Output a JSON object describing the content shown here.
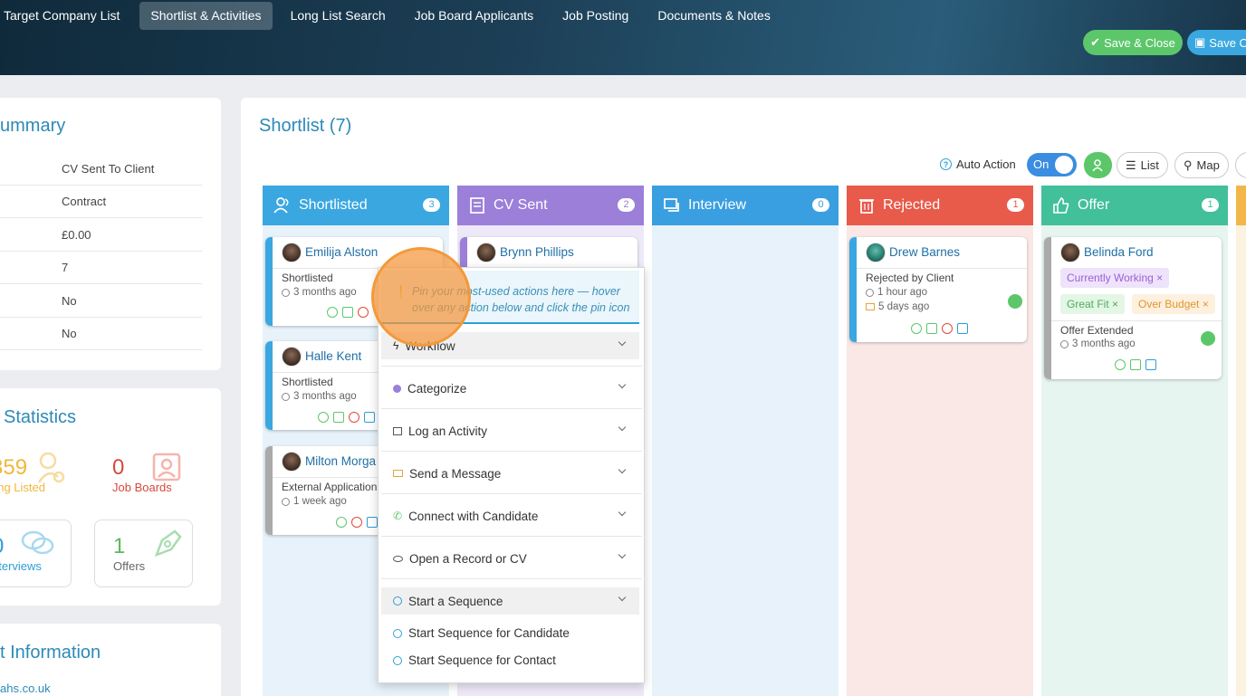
{
  "topbar": {
    "tabs": [
      "Target Company List",
      "Shortlist & Activities",
      "Long List Search",
      "Job Board Applicants",
      "Job Posting",
      "Documents & Notes"
    ],
    "active_tab": "Shortlist & Activities",
    "save_close": "Save & Close",
    "save_only": "Save Or"
  },
  "summary": {
    "title": "ummary",
    "rows": [
      "CV Sent To Client",
      "Contract",
      "£0.00",
      "7",
      "No",
      "No"
    ]
  },
  "statistics": {
    "title": "Statistics",
    "long_listed_num": "359",
    "long_listed_label": "ong Listed",
    "job_boards_num": "0",
    "job_boards_label": "Job Boards",
    "interviews_num": "0",
    "interviews_label": "nterviews",
    "offers_num": "1",
    "offers_label": "Offers"
  },
  "contact": {
    "title": "t Information",
    "email": "ahs.co.uk"
  },
  "main": {
    "title": "Shortlist (7)",
    "auto_action": "Auto Action",
    "toggle": "On",
    "list": "List",
    "map": "Map"
  },
  "columns": [
    {
      "name": "Shortlisted",
      "count": "3",
      "color": "#3aa7e0"
    },
    {
      "name": "CV Sent",
      "count": "2",
      "color": "#9b7fd9"
    },
    {
      "name": "Interview",
      "count": "0",
      "color": "#3a9fe0"
    },
    {
      "name": "Rejected",
      "count": "1",
      "color": "#e85a4a"
    },
    {
      "name": "Offer",
      "count": "1",
      "color": "#42c09a"
    }
  ],
  "cards": {
    "emilija": {
      "name": "Emilija Alston",
      "status": "Shortlisted",
      "time": "3 months ago"
    },
    "halle": {
      "name": "Halle Kent",
      "status": "Shortlisted",
      "time": "3 months ago"
    },
    "milton": {
      "name": "Milton Morga",
      "status": "External Application",
      "time": "1 week ago"
    },
    "brynn": {
      "name": "Brynn Phillips"
    },
    "drew": {
      "name": "Drew Barnes",
      "status": "Rejected by Client",
      "time": "1 hour ago",
      "time2": "5 days ago"
    },
    "belinda": {
      "name": "Belinda Ford",
      "tag1": "Currently Working",
      "tag2": "Great Fit",
      "tag3": "Over Budget",
      "status": "Offer Extended",
      "time": "3 months ago"
    }
  },
  "dropdown": {
    "pin_hint": "Pin your most-used actions here — hover over any action below and click the pin icon",
    "items": [
      "Workflow",
      "Categorize",
      "Log an Activity",
      "Send a Message",
      "Connect with Candidate",
      "Open a Record or CV",
      "Start a Sequence"
    ],
    "sub_items": [
      "Start Sequence for Candidate",
      "Start Sequence for Contact"
    ]
  }
}
